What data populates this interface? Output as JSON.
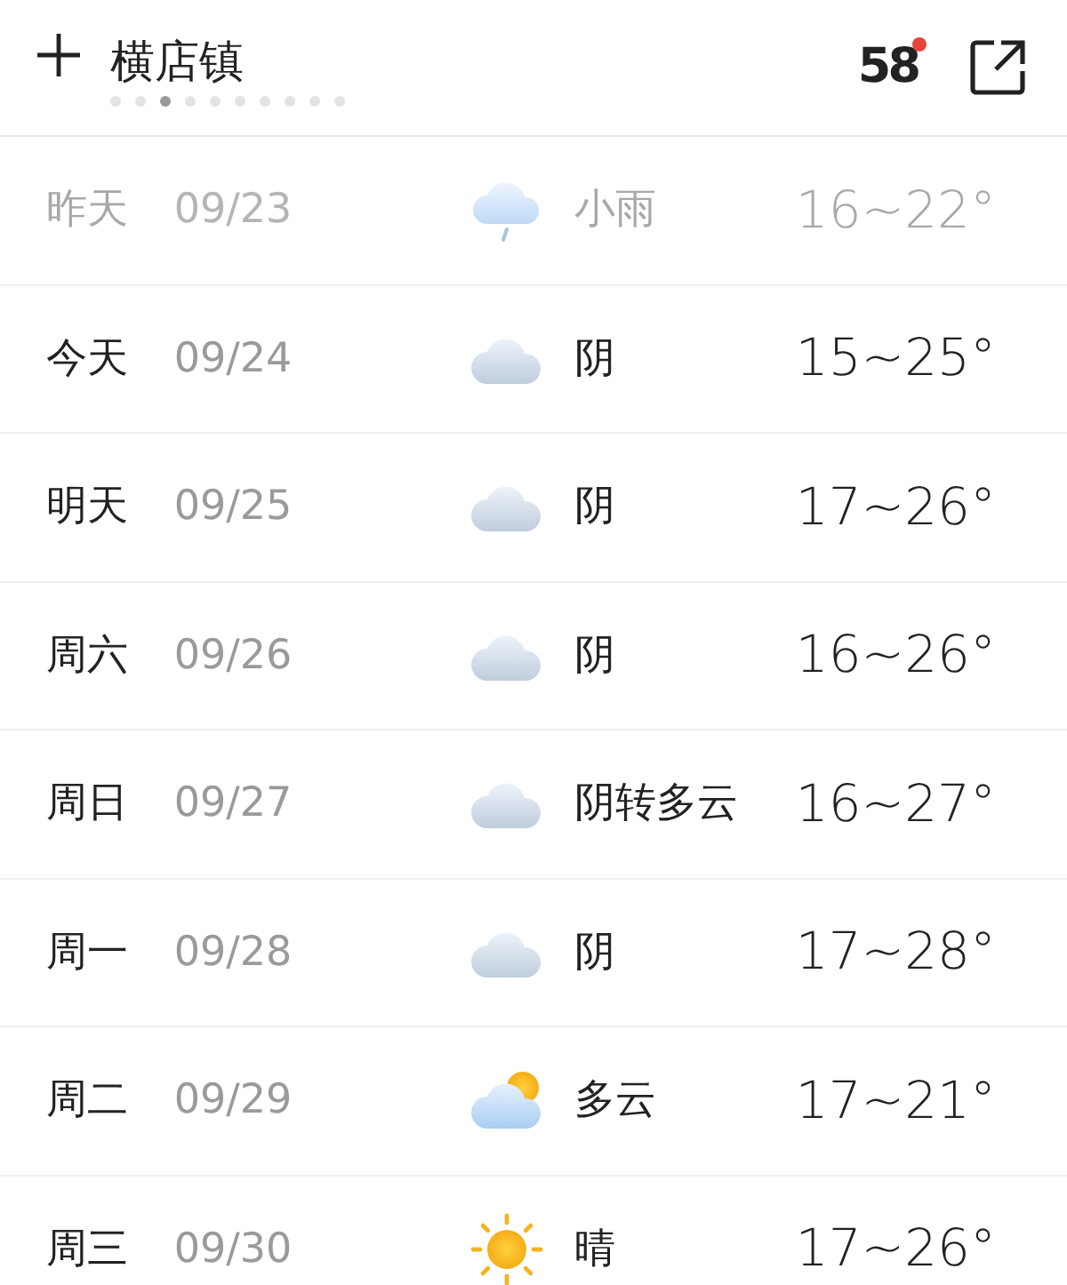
{
  "header": {
    "city": "横店镇",
    "pages": [
      {
        "selected": false
      },
      {
        "selected": false
      },
      {
        "selected": true
      },
      {
        "selected": false
      },
      {
        "selected": false
      },
      {
        "selected": false
      },
      {
        "selected": false
      },
      {
        "selected": false
      },
      {
        "selected": false
      },
      {
        "selected": false
      }
    ],
    "aqi": "58",
    "aqi_alert": true
  },
  "days": [
    {
      "day": "昨天",
      "date": "09/23",
      "kind": "rain",
      "condition": "小雨",
      "temp": "16~22°",
      "past": true
    },
    {
      "day": "今天",
      "date": "09/24",
      "kind": "overcast",
      "condition": "阴",
      "temp": "15~25°",
      "past": false
    },
    {
      "day": "明天",
      "date": "09/25",
      "kind": "overcast",
      "condition": "阴",
      "temp": "17~26°",
      "past": false
    },
    {
      "day": "周六",
      "date": "09/26",
      "kind": "overcast",
      "condition": "阴",
      "temp": "16~26°",
      "past": false
    },
    {
      "day": "周日",
      "date": "09/27",
      "kind": "overcast",
      "condition": "阴转多云",
      "temp": "16~27°",
      "past": false
    },
    {
      "day": "周一",
      "date": "09/28",
      "kind": "overcast",
      "condition": "阴",
      "temp": "17~28°",
      "past": false
    },
    {
      "day": "周二",
      "date": "09/29",
      "kind": "partly-cloudy",
      "condition": "多云",
      "temp": "17~21°",
      "past": false
    },
    {
      "day": "周三",
      "date": "09/30",
      "kind": "sunny",
      "condition": "晴",
      "temp": "17~26°",
      "past": false
    }
  ]
}
